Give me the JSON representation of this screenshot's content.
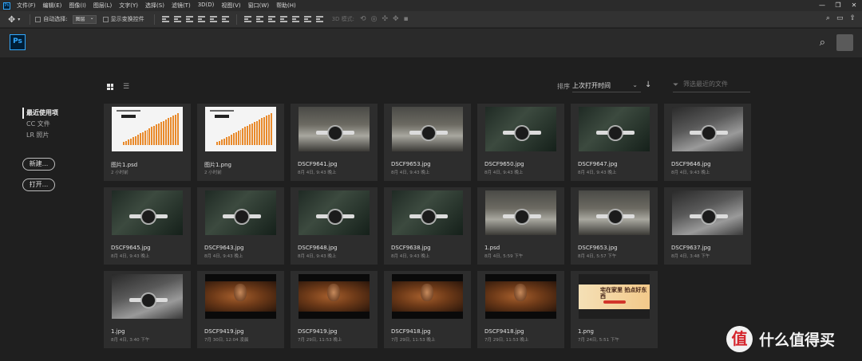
{
  "app": {
    "icon_label": "Ps",
    "menu": [
      "文件(F)",
      "编辑(E)",
      "图像(I)",
      "图层(L)",
      "文字(Y)",
      "选择(S)",
      "滤镜(T)",
      "3D(D)",
      "视图(V)",
      "窗口(W)",
      "帮助(H)"
    ],
    "window_controls": [
      "—",
      "❐",
      "✕"
    ]
  },
  "options": {
    "auto_select_label": "自动选择:",
    "auto_select_value": "图层",
    "show_transform_label": "显示变换控件",
    "mode_3d_label": "3D 模式:"
  },
  "header": {
    "logo": "Ps"
  },
  "sidebar": {
    "items": [
      {
        "label": "最近使用项",
        "active": true
      },
      {
        "label": "CC 文件",
        "active": false
      },
      {
        "label": "LR 照片",
        "active": false
      }
    ],
    "new_button": "新建...",
    "open_button": "打开..."
  },
  "toolbar": {
    "sort_label": "排序",
    "sort_value": "上次打开时间",
    "filter_placeholder": "筛选最近的文件"
  },
  "files": [
    {
      "name": "图片1.psd",
      "meta": "2 小时前",
      "thumb": "chart"
    },
    {
      "name": "图片1.png",
      "meta": "2 小时前",
      "thumb": "chart"
    },
    {
      "name": "DSCF9641.jpg",
      "meta": "8月 4日, 9:43 晚上",
      "thumb": "water"
    },
    {
      "name": "DSCF9653.jpg",
      "meta": "8月 4日, 9:43 晚上",
      "thumb": "water"
    },
    {
      "name": "DSCF9650.jpg",
      "meta": "8月 4日, 9:43 晚上",
      "thumb": "dark"
    },
    {
      "name": "DSCF9647.jpg",
      "meta": "8月 4日, 9:43 晚上",
      "thumb": "dark"
    },
    {
      "name": "DSCF9646.jpg",
      "meta": "8月 4日, 9:43 晚上",
      "thumb": "bw"
    },
    {
      "name": "DSCF9645.jpg",
      "meta": "8月 4日, 9:43 晚上",
      "thumb": "dark"
    },
    {
      "name": "DSCF9643.jpg",
      "meta": "8月 4日, 9:43 晚上",
      "thumb": "dark"
    },
    {
      "name": "DSCF9648.jpg",
      "meta": "8月 4日, 9:43 晚上",
      "thumb": "dark"
    },
    {
      "name": "DSCF9638.jpg",
      "meta": "8月 4日, 9:43 晚上",
      "thumb": "dark"
    },
    {
      "name": "1.psd",
      "meta": "8月 4日, 5:59 下午",
      "thumb": "water"
    },
    {
      "name": "DSCF9653.jpg",
      "meta": "8月 4日, 5:57 下午",
      "thumb": "water"
    },
    {
      "name": "DSCF9637.jpg",
      "meta": "8月 4日, 3:48 下午",
      "thumb": "bw"
    },
    {
      "name": "1.jpg",
      "meta": "8月 4日, 3:40 下午",
      "thumb": "bw"
    },
    {
      "name": "DSCF9419.jpg",
      "meta": "7月 30日, 12:04 凌晨",
      "thumb": "movie"
    },
    {
      "name": "DSCF9419.jpg",
      "meta": "7月 29日, 11:53 晚上",
      "thumb": "movie"
    },
    {
      "name": "DSCF9418.jpg",
      "meta": "7月 29日, 11:53 晚上",
      "thumb": "movie"
    },
    {
      "name": "DSCF9418.jpg",
      "meta": "7月 29日, 11:53 晚上",
      "thumb": "movie"
    },
    {
      "name": "1.png",
      "meta": "7月 24日, 5:51 下午",
      "thumb": "banner"
    }
  ],
  "thumb_text": {
    "chart_title": "一类 降影",
    "banner_text": "宅在家里 拍点好东西"
  },
  "watermark": {
    "logo": "值",
    "text": "什么值得买"
  },
  "colors": {
    "accent": "#31a8ff",
    "bg": "#1f1f1f",
    "card": "#2d2d2d",
    "bar_orange": "#e98a2b"
  }
}
